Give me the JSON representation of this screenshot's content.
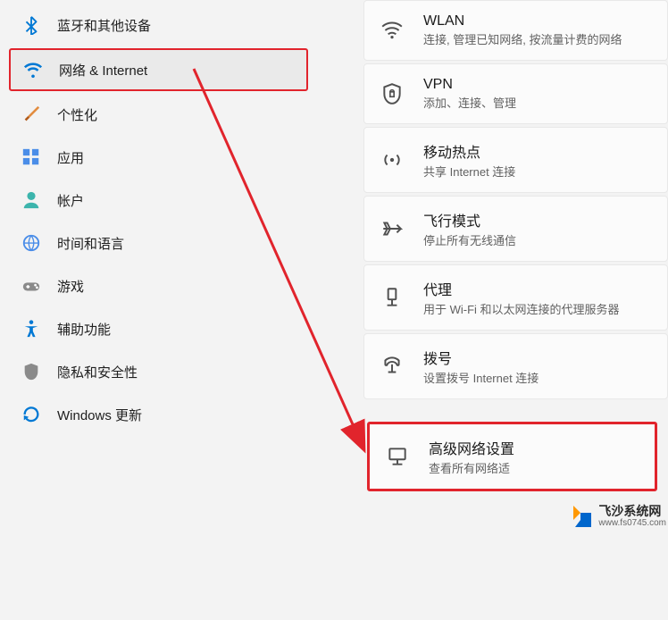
{
  "sidebar": {
    "items": [
      {
        "label": "蓝牙和其他设备",
        "icon": "bluetooth"
      },
      {
        "label": "网络 & Internet",
        "icon": "wifi",
        "selected": true
      },
      {
        "label": "个性化",
        "icon": "brush"
      },
      {
        "label": "应用",
        "icon": "apps"
      },
      {
        "label": "帐户",
        "icon": "user"
      },
      {
        "label": "时间和语言",
        "icon": "globe"
      },
      {
        "label": "游戏",
        "icon": "gamepad"
      },
      {
        "label": "辅助功能",
        "icon": "accessibility"
      },
      {
        "label": "隐私和安全性",
        "icon": "shield"
      },
      {
        "label": "Windows 更新",
        "icon": "update"
      }
    ]
  },
  "content": {
    "items": [
      {
        "title": "WLAN",
        "desc": "连接, 管理已知网络, 按流量计费的网络",
        "icon": "wifi2"
      },
      {
        "title": "VPN",
        "desc": "添加、连接、管理",
        "icon": "vpn"
      },
      {
        "title": "移动热点",
        "desc": "共享 Internet 连接",
        "icon": "hotspot"
      },
      {
        "title": "飞行模式",
        "desc": "停止所有无线通信",
        "icon": "airplane"
      },
      {
        "title": "代理",
        "desc": "用于 Wi-Fi 和以太网连接的代理服务器",
        "icon": "proxy"
      },
      {
        "title": "拨号",
        "desc": "设置拨号 Internet 连接",
        "icon": "dialup"
      },
      {
        "title": "高级网络设置",
        "desc": "查看所有网络适",
        "icon": "monitor",
        "highlighted": true
      }
    ]
  },
  "watermark": {
    "zh": "飞沙系统网",
    "en": "www.fs0745.com"
  },
  "annotation": {
    "color": "#e1242c"
  }
}
